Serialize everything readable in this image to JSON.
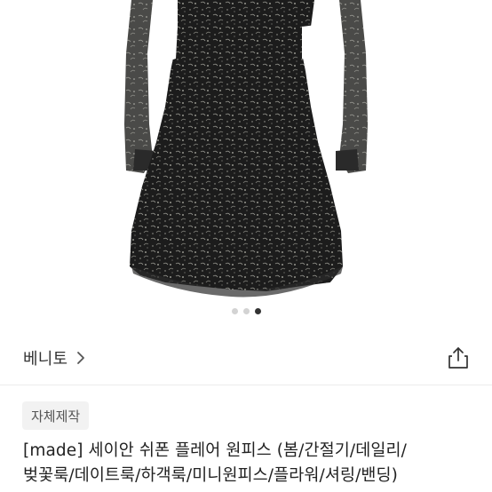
{
  "carousel": {
    "total": 3,
    "active_index": 2
  },
  "seller": {
    "name": "베니토"
  },
  "product": {
    "badge": "자체제작",
    "title_line1": "[made] 세이안 쉬폰 플레어 원피스 (봄/간절기/데일리/",
    "title_line2": "벚꽃룩/데이트룩/하객룩/미니원피스/플라워/셔링/밴딩)"
  },
  "icons": {
    "seller_chevron": "chevron-right-icon",
    "share": "share-icon"
  }
}
